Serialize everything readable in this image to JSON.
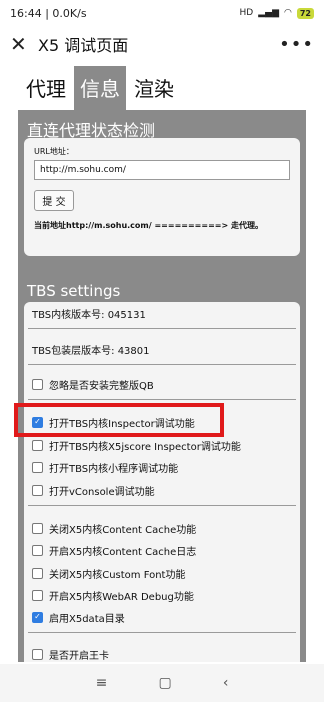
{
  "statusbar": {
    "time": "16:44",
    "net": "| 0.0K/s",
    "signal": "HD",
    "battery": "72"
  },
  "titlebar": {
    "close_glyph": "✕",
    "title": "X5 调试页面",
    "more_glyph": "•••"
  },
  "tabs": [
    {
      "label": "代理",
      "active": false
    },
    {
      "label": "信息",
      "active": true
    },
    {
      "label": "渲染",
      "active": false
    }
  ],
  "proxy_check": {
    "title": "直连代理状态检测",
    "url_label": "URL地址：",
    "url_value": "http://m.sohu.com/",
    "submit_label": "提 交",
    "result": "当前地址http://m.sohu.com/ ==========> 走代理。"
  },
  "tbs": {
    "title": "TBS settings",
    "core_version": "TBS内核版本号: 045131",
    "pack_version": "TBS包装层版本号: 43801",
    "options": [
      {
        "label": "忽略是否安装完整版QB",
        "checked": false
      },
      {
        "label": "打开TBS内核Inspector调试功能",
        "checked": true
      },
      {
        "label": "打开TBS内核X5jscore Inspector调试功能",
        "checked": false
      },
      {
        "label": "打开TBS内核小程序调试功能",
        "checked": false
      },
      {
        "label": "打开vConsole调试功能",
        "checked": false
      },
      {
        "label": "关闭X5内核Content Cache功能",
        "checked": false
      },
      {
        "label": "开启X5内核Content Cache日志",
        "checked": false
      },
      {
        "label": "关闭X5内核Custom Font功能",
        "checked": false
      },
      {
        "label": "开启X5内核WebAR Debug功能",
        "checked": false
      },
      {
        "label": "启用X5data目录",
        "checked": true
      },
      {
        "label": "是否开启王卡",
        "checked": false
      }
    ]
  },
  "navbar": {
    "menu_glyph": "≡",
    "home_glyph": "▢",
    "back_glyph": "‹"
  }
}
